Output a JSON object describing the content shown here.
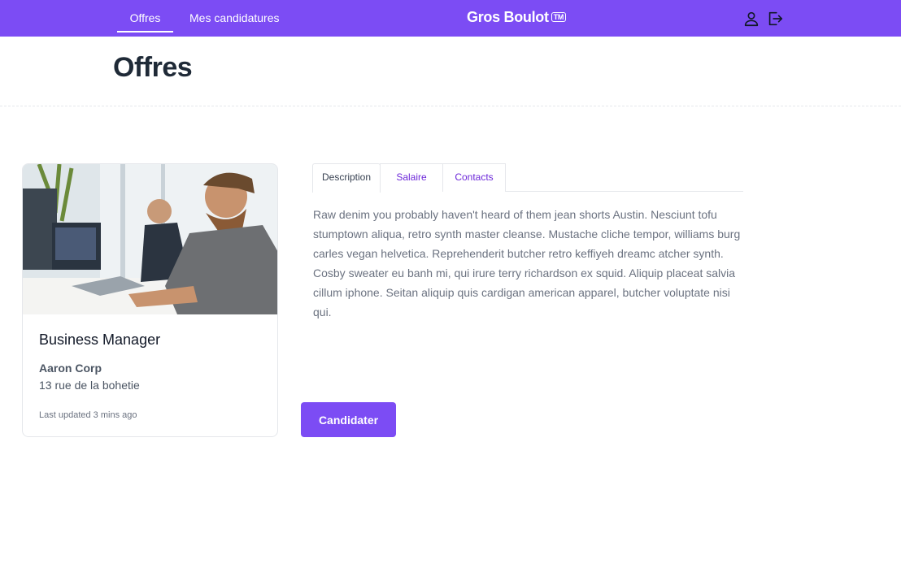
{
  "nav": {
    "links": [
      "Offres",
      "Mes candidatures"
    ],
    "brand": "Gros Boulot",
    "brand_badge": "TM",
    "icons": [
      "user-icon",
      "logout-icon"
    ]
  },
  "header": {
    "title": "Offres"
  },
  "offer": {
    "title": "Business Manager",
    "company": "Aaron Corp",
    "address": "13 rue de la bohetie",
    "updated": "Last updated 3 mins ago"
  },
  "tabs": [
    {
      "label": "Description",
      "active": true
    },
    {
      "label": "Salaire",
      "active": false
    },
    {
      "label": "Contacts",
      "active": false
    }
  ],
  "description": "Raw denim you probably haven't heard of them jean shorts Austin. Nesciunt tofu stumptown aliqua, retro synth master cleanse. Mustache cliche tempor, williams burg carles vegan helvetica. Reprehenderit butcher retro keffiyeh dreamc atcher synth. Cosby sweater eu banh mi, qui irure terry richardson ex squid. Aliquip placeat salvia cillum iphone. Seitan aliquip quis cardigan american apparel, butcher voluptate nisi qui.",
  "apply_label": "Candidater",
  "colors": {
    "accent": "#7c4cf4",
    "tab_link": "#6d28d9",
    "muted_text": "#6b7280"
  }
}
